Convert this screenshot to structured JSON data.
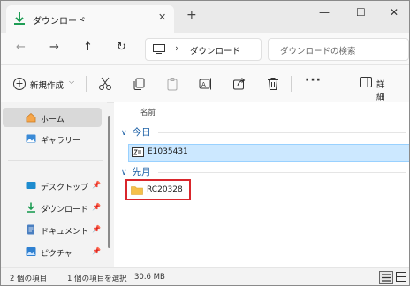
{
  "tab": {
    "title": "ダウンロード",
    "close": "✕",
    "new_tab": "+"
  },
  "window_controls": {
    "minimize": "—",
    "maximize": "☐",
    "close": "✕"
  },
  "nav": {
    "back": "←",
    "forward": "→",
    "up": "↑",
    "refresh": "↻",
    "separator": "›"
  },
  "address": {
    "crumb": "ダウンロード"
  },
  "search": {
    "placeholder": "ダウンロードの検索"
  },
  "command_bar": {
    "new_label": "新規作成",
    "new_dropdown": "⌵",
    "more": "···",
    "details_label": "詳細"
  },
  "sidebar": {
    "items": [
      {
        "label": "ホーム",
        "icon": "home-icon",
        "selected": true
      },
      {
        "label": "ギャラリー",
        "icon": "gallery-icon"
      },
      {
        "label": "デスクトップ",
        "icon": "desktop-icon",
        "pinned": true
      },
      {
        "label": "ダウンロード",
        "icon": "download-icon",
        "pinned": true
      },
      {
        "label": "ドキュメント",
        "icon": "documents-icon",
        "pinned": true
      },
      {
        "label": "ピクチャ",
        "icon": "pictures-icon",
        "pinned": true
      }
    ],
    "pin_glyph": "📌"
  },
  "content": {
    "column_header": "名前",
    "groups": [
      {
        "label": "今日",
        "chevron": "∨",
        "files": [
          {
            "name": "E1035431",
            "icon": "zip-file-icon",
            "selected": true
          }
        ]
      },
      {
        "label": "先月",
        "chevron": "∨",
        "files": [
          {
            "name": "RC20328",
            "icon": "folder-icon",
            "highlighted": true
          }
        ]
      }
    ]
  },
  "status": {
    "item_count": "2 個の項目",
    "selection": "1 個の項目を選択",
    "size": "30.6 MB"
  },
  "colors": {
    "accent": "#1b5fa5",
    "selection_bg": "#cce8ff",
    "highlight_box": "#d9262c",
    "folder": "#f5c04a",
    "download_green": "#1f9d55"
  }
}
